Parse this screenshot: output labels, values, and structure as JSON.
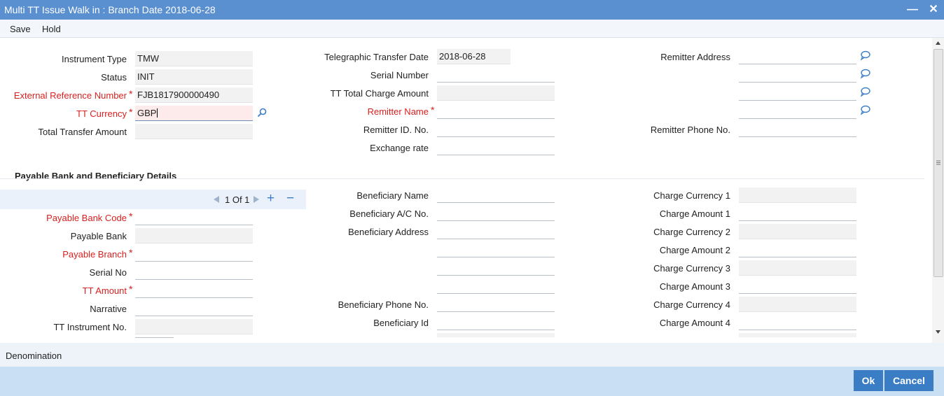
{
  "window": {
    "title": "Multi TT Issue Walk in : Branch Date 2018-06-28",
    "minimize_glyph": "—",
    "close_glyph": "✕"
  },
  "menu": {
    "save": "Save",
    "hold": "Hold"
  },
  "left": {
    "instrument_type": {
      "label": "Instrument Type",
      "value": "TMW"
    },
    "status": {
      "label": "Status",
      "value": "INIT"
    },
    "ext_ref": {
      "label": "External Reference Number",
      "value": "FJB1817900000490"
    },
    "tt_currency": {
      "label": "TT Currency",
      "value": "GBP"
    },
    "total_transfer": {
      "label": "Total Transfer Amount",
      "value": ""
    }
  },
  "middle": {
    "tt_date": {
      "label": "Telegraphic Transfer Date",
      "value": "2018-06-28"
    },
    "serial_number": {
      "label": "Serial Number",
      "value": ""
    },
    "tt_total_charge": {
      "label": "TT Total Charge Amount",
      "value": ""
    },
    "remitter_name": {
      "label": "Remitter Name",
      "value": ""
    },
    "remitter_id": {
      "label": "Remitter ID. No.",
      "value": ""
    },
    "exchange_rate": {
      "label": "Exchange rate",
      "value": ""
    }
  },
  "right": {
    "remitter_address": {
      "label": "Remitter Address",
      "lines": [
        "",
        "",
        "",
        ""
      ]
    },
    "remitter_phone": {
      "label": "Remitter Phone No.",
      "value": ""
    }
  },
  "section": {
    "title": "Payable Bank and Beneficiary Details"
  },
  "pager": {
    "text": "1 Of 1",
    "add": "+",
    "remove": "−"
  },
  "bank": {
    "payable_bank_code": {
      "label": "Payable Bank Code",
      "value": ""
    },
    "payable_bank": {
      "label": "Payable Bank",
      "value": ""
    },
    "payable_branch": {
      "label": "Payable Branch",
      "value": ""
    },
    "serial_no": {
      "label": "Serial No",
      "value": ""
    },
    "tt_amount": {
      "label": "TT Amount",
      "value": ""
    },
    "narrative": {
      "label": "Narrative",
      "value": ""
    },
    "tt_instrument_no": {
      "label": "TT Instrument No.",
      "value": ""
    }
  },
  "beneficiary": {
    "name": {
      "label": "Beneficiary Name",
      "value": ""
    },
    "account": {
      "label": "Beneficiary A/C No.",
      "value": ""
    },
    "address": {
      "label": "Beneficiary Address",
      "lines": [
        "",
        "",
        "",
        ""
      ]
    },
    "phone": {
      "label": "Beneficiary Phone No.",
      "value": ""
    },
    "id": {
      "label": "Beneficiary Id",
      "value": ""
    }
  },
  "charges": {
    "cc1": {
      "label": "Charge Currency 1",
      "value": ""
    },
    "ca1": {
      "label": "Charge Amount 1",
      "value": ""
    },
    "cc2": {
      "label": "Charge Currency 2",
      "value": ""
    },
    "ca2": {
      "label": "Charge Amount 2",
      "value": ""
    },
    "cc3": {
      "label": "Charge Currency 3",
      "value": ""
    },
    "ca3": {
      "label": "Charge Amount 3",
      "value": ""
    },
    "cc4": {
      "label": "Charge Currency 4",
      "value": ""
    },
    "ca4": {
      "label": "Charge Amount 4",
      "value": ""
    }
  },
  "footer": {
    "denomination": "Denomination",
    "ok": "Ok",
    "cancel": "Cancel"
  },
  "colors": {
    "titlebar": "#5a8fd0",
    "required": "#d8201f",
    "button": "#3a7dc4",
    "bottombar": "#c9dff3",
    "icon": "#3b7ec7"
  }
}
